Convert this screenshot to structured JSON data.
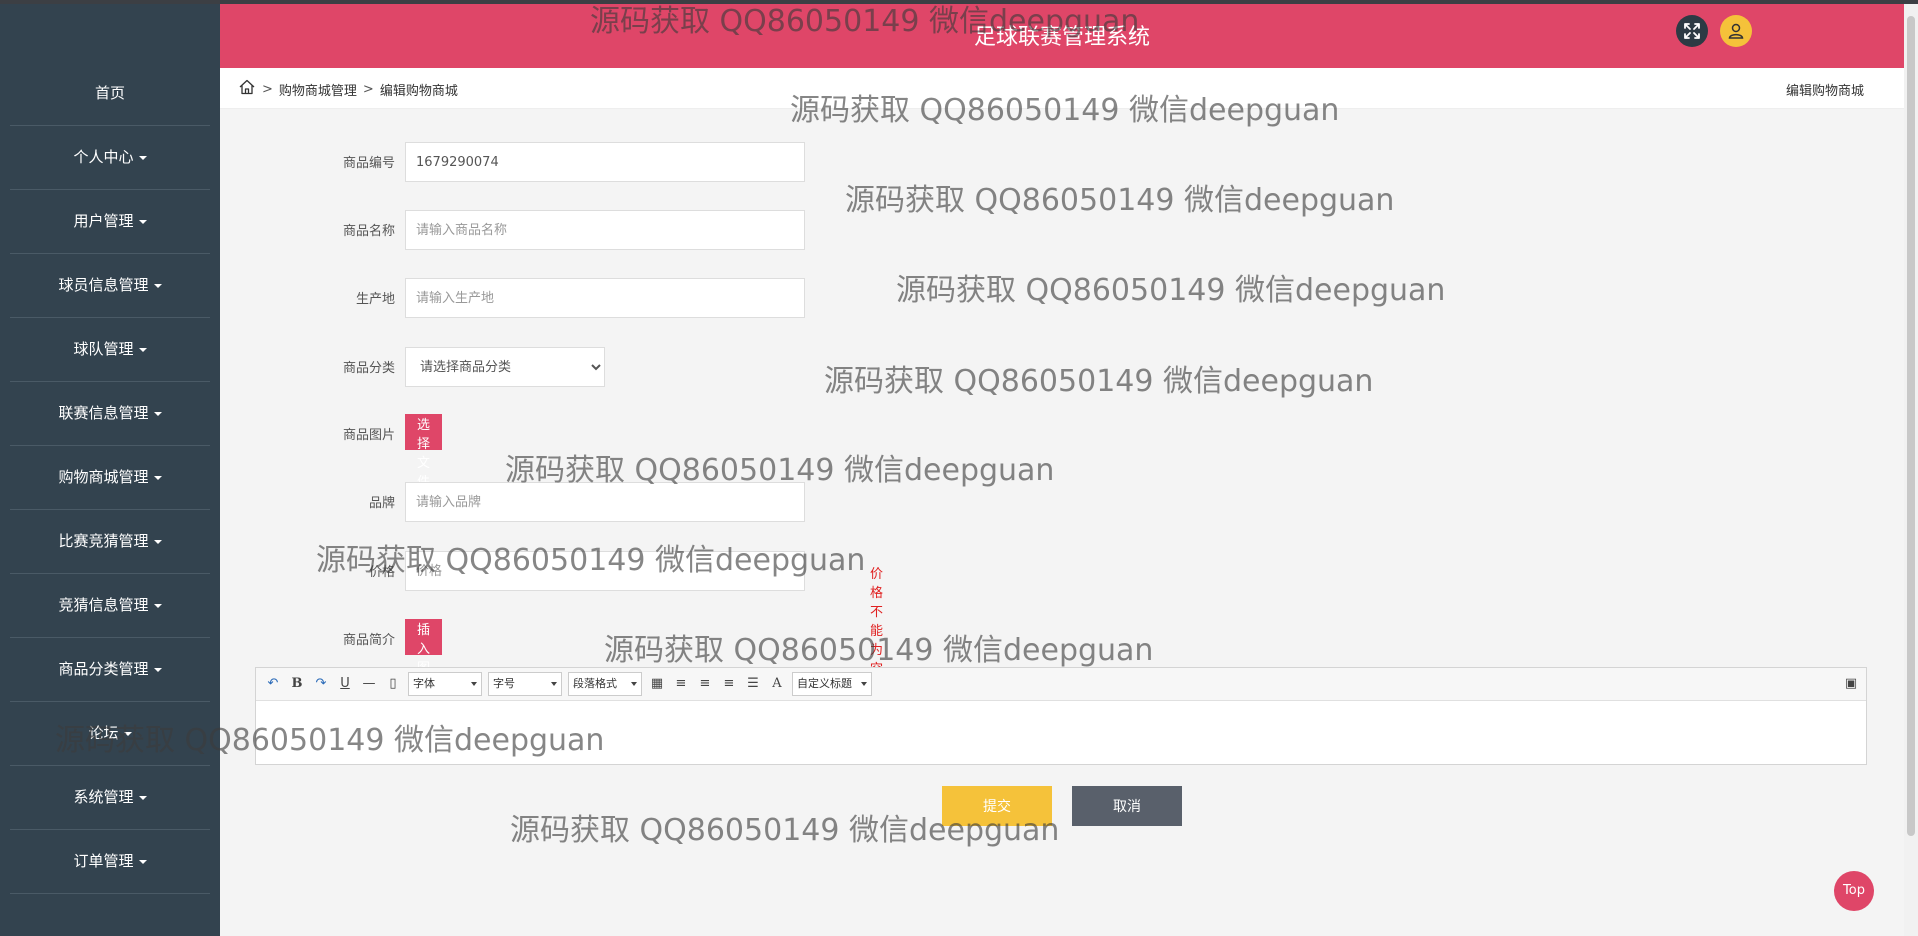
{
  "app": {
    "title": "足球联赛管理系统"
  },
  "sidebar": {
    "items": [
      {
        "label": "首页",
        "has_caret": false
      },
      {
        "label": "个人中心",
        "has_caret": true
      },
      {
        "label": "用户管理",
        "has_caret": true
      },
      {
        "label": "球员信息管理",
        "has_caret": true
      },
      {
        "label": "球队管理",
        "has_caret": true
      },
      {
        "label": "联赛信息管理",
        "has_caret": true
      },
      {
        "label": "购物商城管理",
        "has_caret": true
      },
      {
        "label": "比赛竞猜管理",
        "has_caret": true
      },
      {
        "label": "竞猜信息管理",
        "has_caret": true
      },
      {
        "label": "商品分类管理",
        "has_caret": true
      },
      {
        "label": "论坛",
        "has_caret": true
      },
      {
        "label": "系统管理",
        "has_caret": true
      },
      {
        "label": "订单管理",
        "has_caret": true
      }
    ]
  },
  "breadcrumb": {
    "sep": ">",
    "items": [
      "购物商城管理",
      "编辑购物商城"
    ],
    "right_title": "编辑购物商城"
  },
  "form": {
    "product_code": {
      "label": "商品编号",
      "value": "1679290074"
    },
    "product_name": {
      "label": "商品名称",
      "placeholder": "请输入商品名称"
    },
    "origin": {
      "label": "生产地",
      "placeholder": "请输入生产地"
    },
    "category": {
      "label": "商品分类",
      "selected": "请选择商品分类"
    },
    "image": {
      "label": "商品图片",
      "button": "选择文件"
    },
    "brand": {
      "label": "品牌",
      "placeholder": "请输入品牌"
    },
    "price": {
      "label": "价格",
      "placeholder": "价格",
      "error": "价格不能为空"
    },
    "intro": {
      "label": "商品简介",
      "button": "插入图片"
    }
  },
  "editor": {
    "font_label": "字体",
    "size_label": "字号",
    "para_label": "段落格式",
    "custom_label": "自定义标题"
  },
  "actions": {
    "submit": "提交",
    "cancel": "取消",
    "top": "Top"
  },
  "watermark": {
    "text": "源码获取 QQ86050149 微信deepguan"
  },
  "colors": {
    "header": "#df4668",
    "sidebar": "#33434f",
    "submit": "#f5c23a",
    "cancel": "#59606b"
  }
}
